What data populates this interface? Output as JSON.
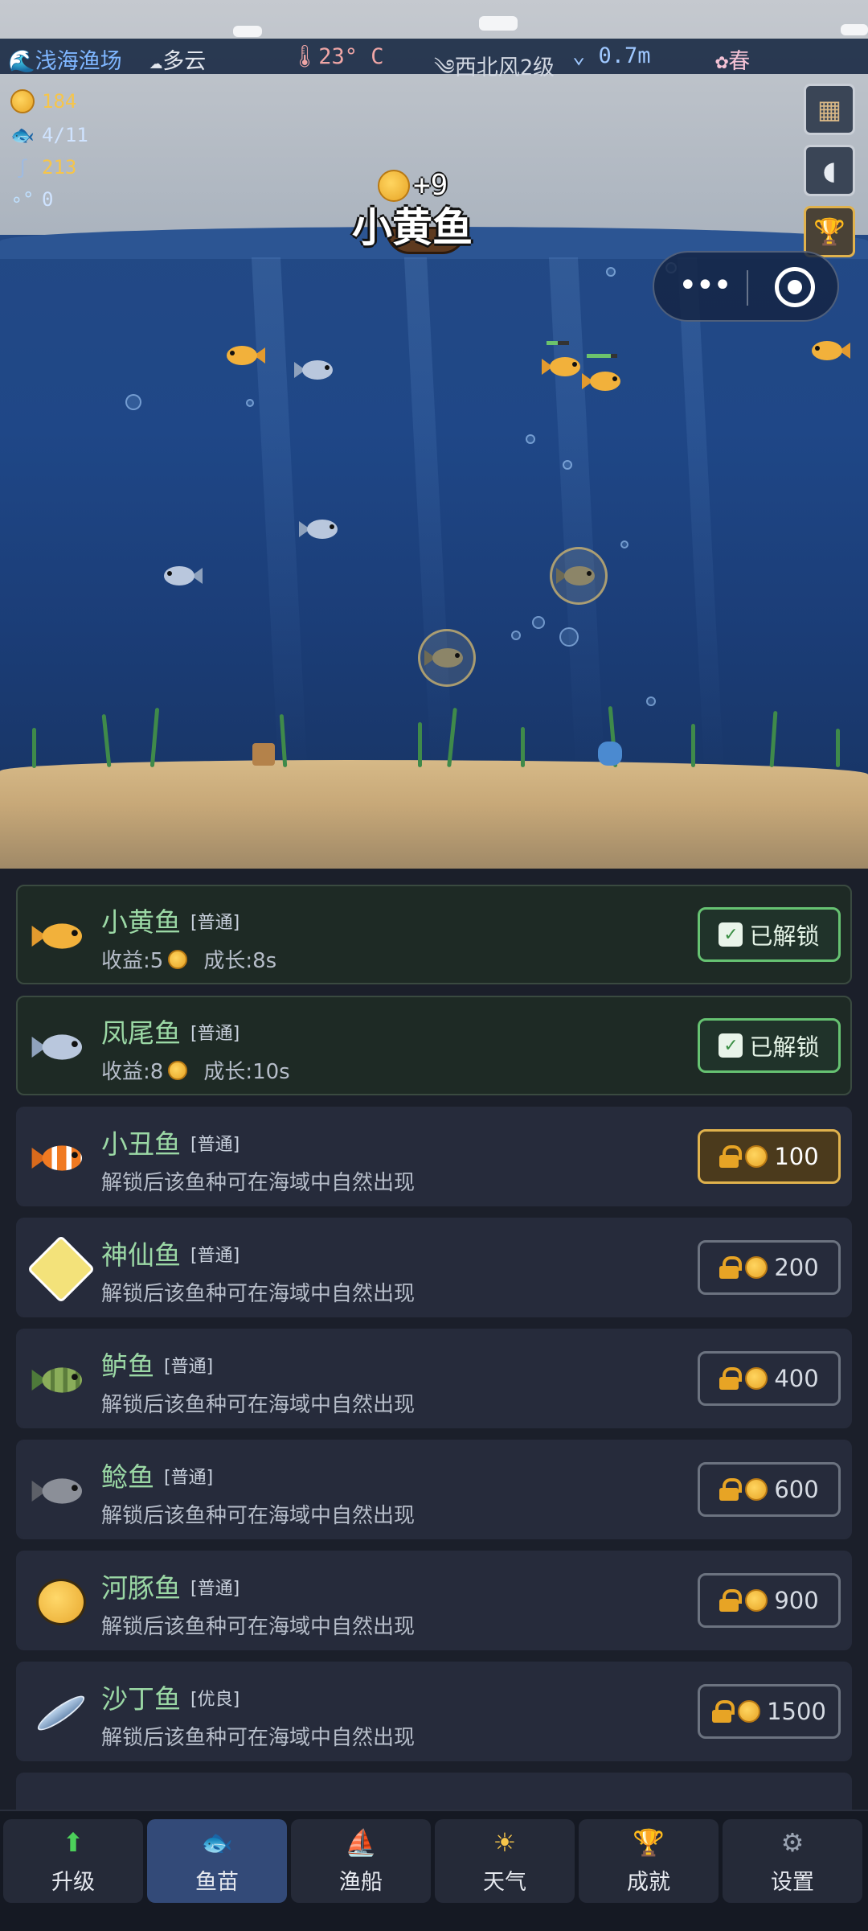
{
  "status_bar": {
    "location": "浅海渔场",
    "weather": "多云",
    "temperature": "23° C",
    "wind": "西北风2级",
    "wave": "0.7m",
    "season": "春"
  },
  "resources": {
    "coins": "184",
    "fish_count": "4/11",
    "bait": "213",
    "bubbles": "0"
  },
  "scene": {
    "floating_fish_name": "小黄鱼",
    "floating_gain": "+9"
  },
  "species": [
    {
      "name": "小黄鱼",
      "rarity": "[普通]",
      "desc_income": "收益:5",
      "desc_growth": "成长:8s",
      "button": "已解锁",
      "state": "unlocked"
    },
    {
      "name": "凤尾鱼",
      "rarity": "[普通]",
      "desc_income": "收益:8",
      "desc_growth": "成长:10s",
      "button": "已解锁",
      "state": "unlocked"
    },
    {
      "name": "小丑鱼",
      "rarity": "[普通]",
      "description": "解锁后该鱼种可在海域中自然出现",
      "button": "100",
      "state": "next"
    },
    {
      "name": "神仙鱼",
      "rarity": "[普通]",
      "description": "解锁后该鱼种可在海域中自然出现",
      "button": "200",
      "state": "locked"
    },
    {
      "name": "鲈鱼",
      "rarity": "[普通]",
      "description": "解锁后该鱼种可在海域中自然出现",
      "button": "400",
      "state": "locked"
    },
    {
      "name": "鲶鱼",
      "rarity": "[普通]",
      "description": "解锁后该鱼种可在海域中自然出现",
      "button": "600",
      "state": "locked"
    },
    {
      "name": "河豚鱼",
      "rarity": "[普通]",
      "description": "解锁后该鱼种可在海域中自然出现",
      "button": "900",
      "state": "locked"
    },
    {
      "name": "沙丁鱼",
      "rarity": "[优良]",
      "description": "解锁后该鱼种可在海域中自然出现",
      "button": "1500",
      "state": "locked"
    }
  ],
  "nav": [
    {
      "label": "升级",
      "icon": "upgrade-arrow-icon"
    },
    {
      "label": "鱼苗",
      "icon": "fish-fry-icon"
    },
    {
      "label": "渔船",
      "icon": "boat-icon"
    },
    {
      "label": "天气",
      "icon": "sun-icon"
    },
    {
      "label": "成就",
      "icon": "trophy-icon"
    },
    {
      "label": "设置",
      "icon": "gear-icon"
    }
  ],
  "colors": {
    "sea": "#1f4787",
    "sand": "#c7a878",
    "accent_green": "#66c272",
    "accent_gold": "#e0b24d",
    "nav_active": "#334a78"
  }
}
